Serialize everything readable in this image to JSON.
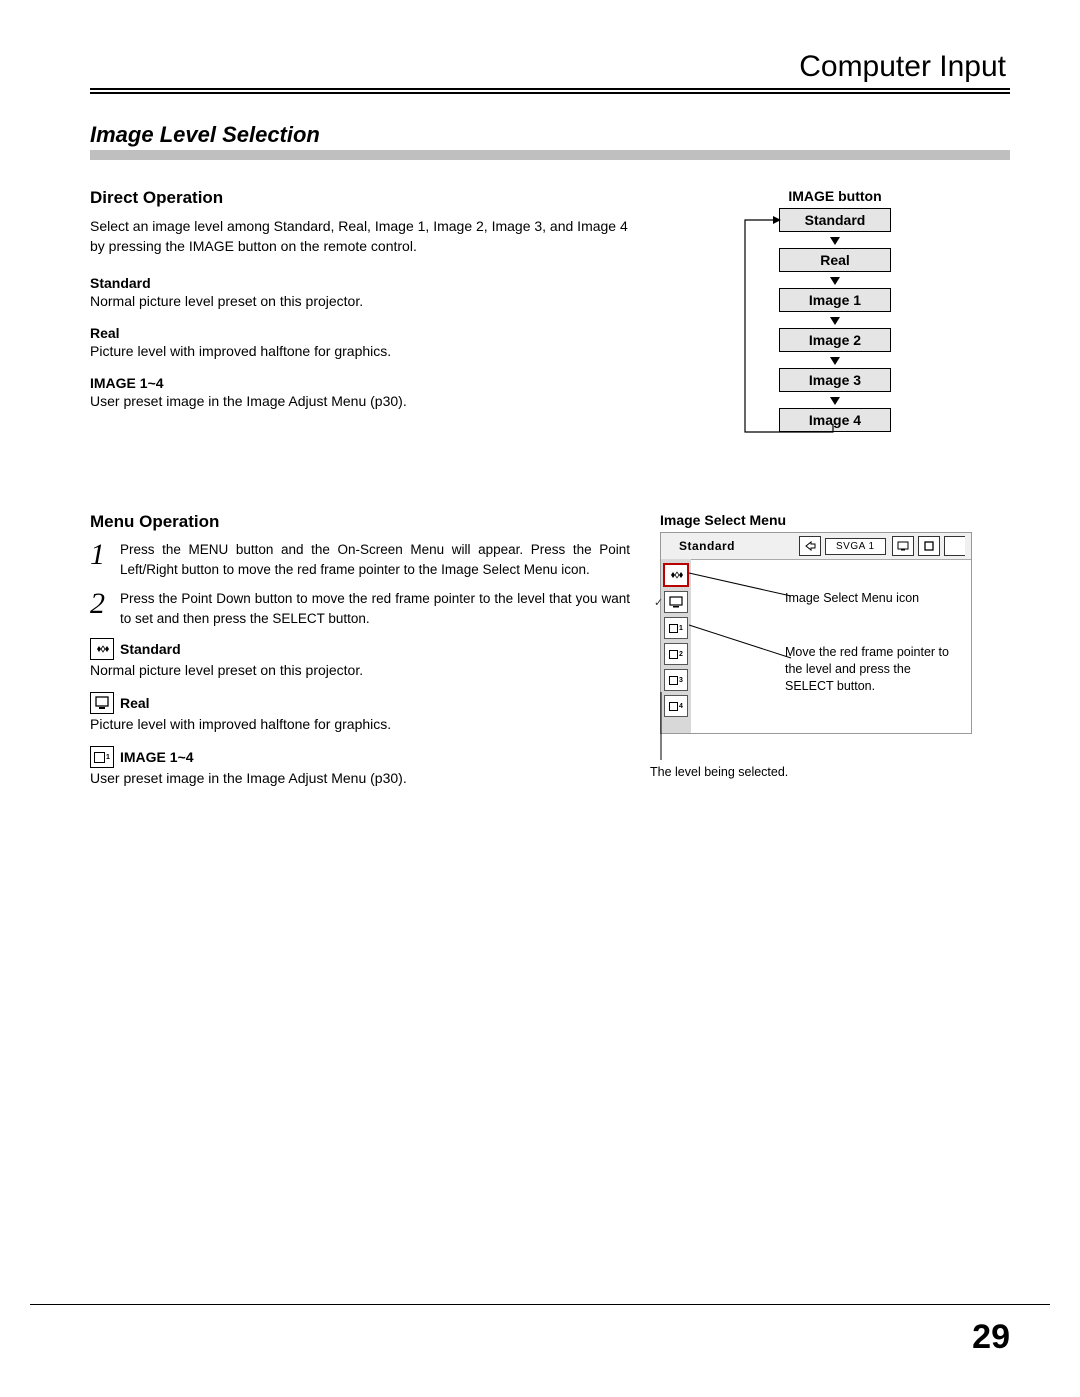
{
  "header": {
    "title": "Computer Input"
  },
  "section_title": "Image Level Selection",
  "direct_op": {
    "heading": "Direct Operation",
    "intro": "Select an image level among Standard, Real, Image 1, Image 2, Image 3, and Image 4 by pressing the IMAGE button on the remote control.",
    "items": [
      {
        "h": "Standard",
        "p": "Normal picture level preset on this projector."
      },
      {
        "h": "Real",
        "p": "Picture level with improved halftone for graphics."
      },
      {
        "h": "IMAGE 1~4",
        "p": "User preset image in the Image Adjust Menu (p30)."
      }
    ]
  },
  "flow": {
    "title": "IMAGE button",
    "boxes": [
      "Standard",
      "Real",
      "Image 1",
      "Image 2",
      "Image 3",
      "Image 4"
    ]
  },
  "menu_op": {
    "heading": "Menu Operation",
    "steps": [
      {
        "n": "1",
        "t": "Press the MENU button and the On-Screen Menu will appear. Press the Point Left/Right button to move the red frame pointer to the Image Select Menu icon."
      },
      {
        "n": "2",
        "t": "Press the Point Down button to move the red frame pointer to the level that you want to set and then press the SELECT button."
      }
    ],
    "icons": [
      {
        "label": "Standard",
        "desc": "Normal picture level preset on this projector."
      },
      {
        "label": "Real",
        "desc": "Picture level with improved halftone for graphics."
      },
      {
        "label": "IMAGE 1~4",
        "desc": "User preset image in the Image Adjust Menu (p30)."
      }
    ]
  },
  "menu_shot": {
    "title": "Image Select Menu",
    "top_label": "Standard",
    "svga": "SVGA 1",
    "callout1": "Image Select Menu icon",
    "callout2": "Move the red frame pointer to the level and press the SELECT button.",
    "callout3": "The level being selected."
  },
  "page_number": "29"
}
